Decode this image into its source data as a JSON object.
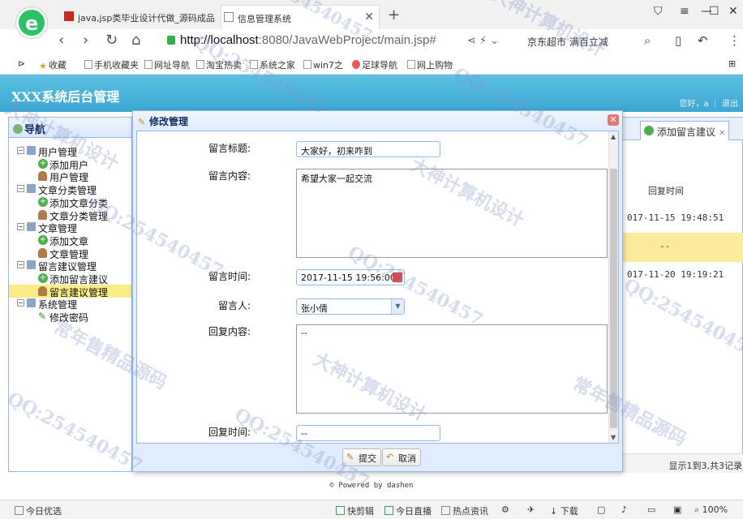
{
  "browser": {
    "tabs": [
      {
        "title": "java,jsp类毕业设计代做_源码成品",
        "favicon": "red-square-icon"
      },
      {
        "title": "信息管理系统",
        "favicon": "page-icon"
      }
    ],
    "url_host": "http://localhost",
    "url_path": ":8080/JavaWebProject/main.jsp#",
    "promo": "京东超市 满百立减",
    "bookmarks": [
      "收藏",
      "手机收藏夹",
      "网址导航",
      "淘宝热卖",
      "系统之家",
      "win7之",
      "足球导航",
      "网上购物"
    ]
  },
  "app": {
    "title": "XXX系统后台管理",
    "greeting": "您好，a ｜ 退出"
  },
  "nav": {
    "title": "导航",
    "items": [
      {
        "label": "用户管理",
        "level": 0
      },
      {
        "label": "添加用户",
        "level": 1
      },
      {
        "label": "用户管理",
        "level": 1
      },
      {
        "label": "文章分类管理",
        "level": 0
      },
      {
        "label": "添加文章分类",
        "level": 1
      },
      {
        "label": "文章分类管理",
        "level": 1
      },
      {
        "label": "文章管理",
        "level": 0
      },
      {
        "label": "添加文章",
        "level": 1
      },
      {
        "label": "文章管理",
        "level": 1
      },
      {
        "label": "留言建议管理",
        "level": 0
      },
      {
        "label": "添加留言建议",
        "level": 1
      },
      {
        "label": "留言建议管理",
        "level": 1
      },
      {
        "label": "系统管理",
        "level": 0
      },
      {
        "label": "修改密码",
        "level": 1
      }
    ]
  },
  "background": {
    "tab_label": "添加留言建议",
    "column_header": "回复时间",
    "rows": [
      "017-11-15 19:48:51",
      "--",
      "017-11-20 19:19:21"
    ],
    "footer": "显示1到3,共3记录"
  },
  "dialog": {
    "title": "修改管理",
    "labels": {
      "title": "留言标题:",
      "content": "留言内容:",
      "time": "留言时间:",
      "person": "留言人:",
      "reply": "回复内容:",
      "reply_time": "回复时间:"
    },
    "values": {
      "title": "大家好，初来咋到",
      "content": "希望大家一起交流",
      "time": "2017-11-15 19:56:00",
      "person": "张小倩",
      "reply": "--",
      "reply_time": "--"
    },
    "buttons": {
      "submit": "提交",
      "cancel": "取消"
    }
  },
  "powered": "© Powered by dashen",
  "statusbar": {
    "left": "今日优选",
    "items": [
      "快剪辑",
      "今日直播",
      "热点资讯",
      "下载",
      "100%"
    ]
  },
  "watermarks": [
    "QQ:254540457",
    "大神计算机设计",
    "常年售精品源码"
  ]
}
